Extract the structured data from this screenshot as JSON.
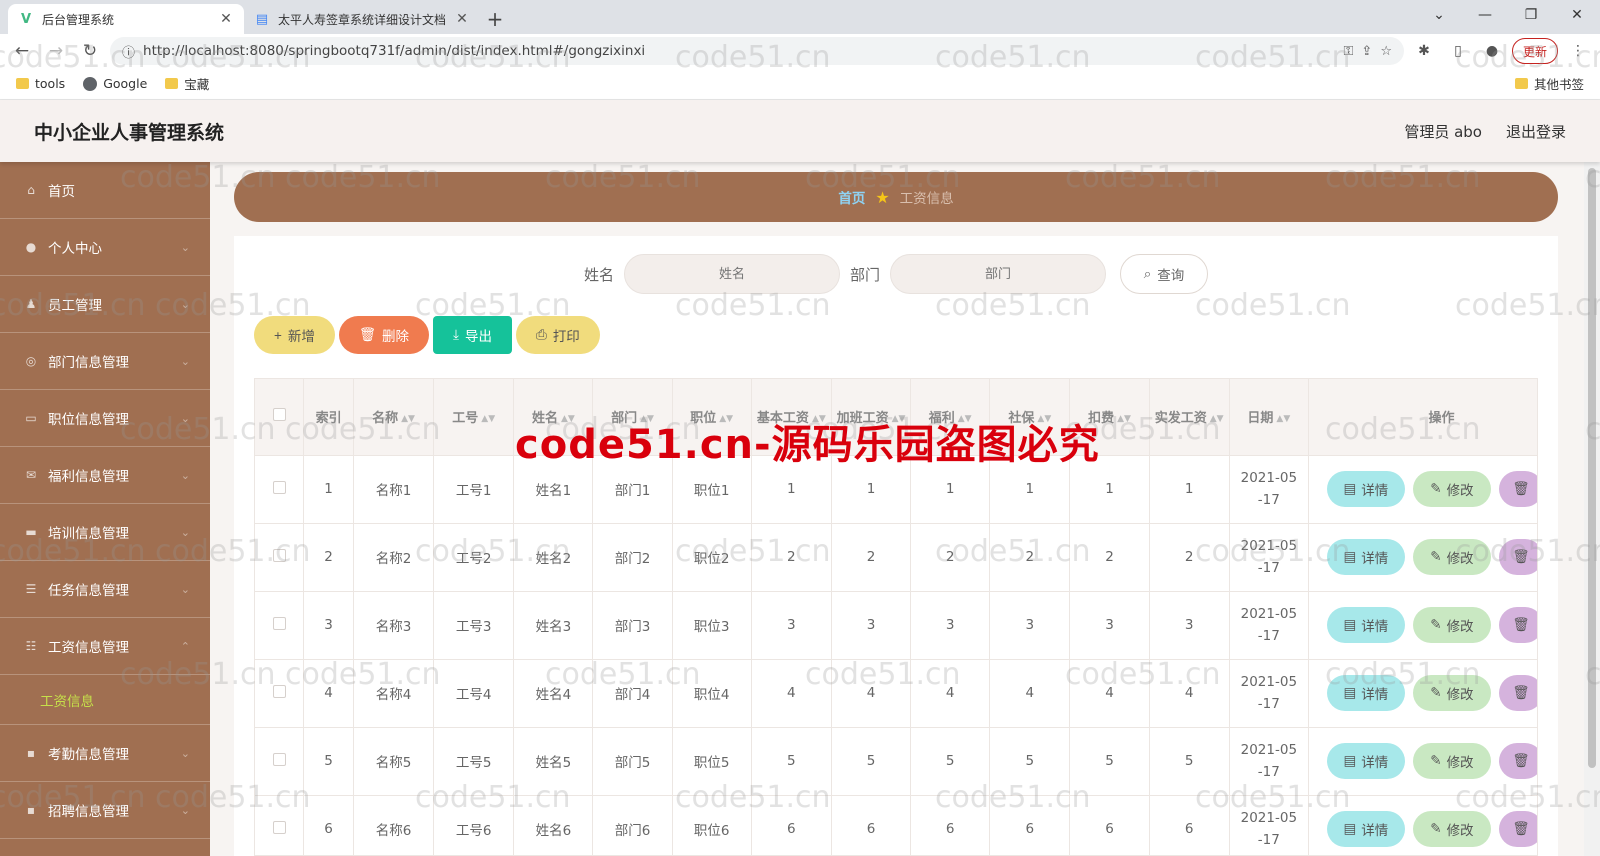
{
  "browser": {
    "tabs": [
      {
        "title": "后台管理系统",
        "icon": "vue-icon",
        "active": true
      },
      {
        "title": "太平人寿签章系统详细设计文档",
        "icon": "doc-icon",
        "active": false
      }
    ],
    "url": "http://localhost:8080/springbootq731f/admin/dist/index.html#/gongzixinxi",
    "update_label": "更新",
    "bookmarks": [
      "tools",
      "Google",
      "宝藏"
    ],
    "other_bookmarks": "其他书签"
  },
  "app": {
    "title": "中小企业人事管理系统",
    "user": "管理员 abo",
    "logout": "退出登录"
  },
  "sidebar": {
    "items": [
      {
        "label": "首页",
        "icon": "home-icon"
      },
      {
        "label": "个人中心",
        "icon": "user-icon"
      },
      {
        "label": "员工管理",
        "icon": "staff-icon"
      },
      {
        "label": "部门信息管理",
        "icon": "dept-icon"
      },
      {
        "label": "职位信息管理",
        "icon": "position-icon"
      },
      {
        "label": "福利信息管理",
        "icon": "mail-icon"
      },
      {
        "label": "培训信息管理",
        "icon": "chat-icon"
      },
      {
        "label": "任务信息管理",
        "icon": "task-icon"
      },
      {
        "label": "工资信息管理",
        "icon": "salary-icon"
      },
      {
        "label": "考勤信息管理",
        "icon": "attendance-icon"
      },
      {
        "label": "招聘信息管理",
        "icon": "recruit-icon"
      }
    ],
    "active_sub": "工资信息"
  },
  "breadcrumb": {
    "home": "首页",
    "current": "工资信息"
  },
  "search": {
    "name_label": "姓名",
    "name_placeholder": "姓名",
    "dept_label": "部门",
    "dept_placeholder": "部门",
    "query_label": "查询"
  },
  "actions": {
    "add": "新增",
    "delete": "删除",
    "export": "导出",
    "print": "打印"
  },
  "table": {
    "columns": [
      "索引",
      "名称",
      "工号",
      "姓名",
      "部门",
      "职位",
      "基本工资",
      "加班工资",
      "福利",
      "社保",
      "扣费",
      "实发工资",
      "日期",
      "操作"
    ],
    "rows": [
      [
        "1",
        "名称1",
        "工号1",
        "姓名1",
        "部门1",
        "职位1",
        "1",
        "1",
        "1",
        "1",
        "1",
        "1",
        "2021-05-17"
      ],
      [
        "2",
        "名称2",
        "工号2",
        "姓名2",
        "部门2",
        "职位2",
        "2",
        "2",
        "2",
        "2",
        "2",
        "2",
        "2021-05-17"
      ],
      [
        "3",
        "名称3",
        "工号3",
        "姓名3",
        "部门3",
        "职位3",
        "3",
        "3",
        "3",
        "3",
        "3",
        "3",
        "2021-05-17"
      ],
      [
        "4",
        "名称4",
        "工号4",
        "姓名4",
        "部门4",
        "职位4",
        "4",
        "4",
        "4",
        "4",
        "4",
        "4",
        "2021-05-17"
      ],
      [
        "5",
        "名称5",
        "工号5",
        "姓名5",
        "部门5",
        "职位5",
        "5",
        "5",
        "5",
        "5",
        "5",
        "5",
        "2021-05-17"
      ],
      [
        "6",
        "名称6",
        "工号6",
        "姓名6",
        "部门6",
        "职位6",
        "6",
        "6",
        "6",
        "6",
        "6",
        "6",
        "2021-05-17"
      ]
    ],
    "op_detail": "详情",
    "op_edit": "修改"
  },
  "watermark": {
    "small": "code51.cn",
    "big": "code51.cn-源码乐园盗图必究"
  },
  "colors": {
    "sidebar": "#a06f51",
    "header": "#f6f1ef",
    "submenu_active": "#c6e04a",
    "detail_btn": "#a7e8ea",
    "edit_btn": "#c9e8c2",
    "delete_btn": "#f07b4f",
    "export_btn": "#15c29a",
    "add_btn": "#f1dc7d",
    "watermark_big": "#d9000c"
  }
}
